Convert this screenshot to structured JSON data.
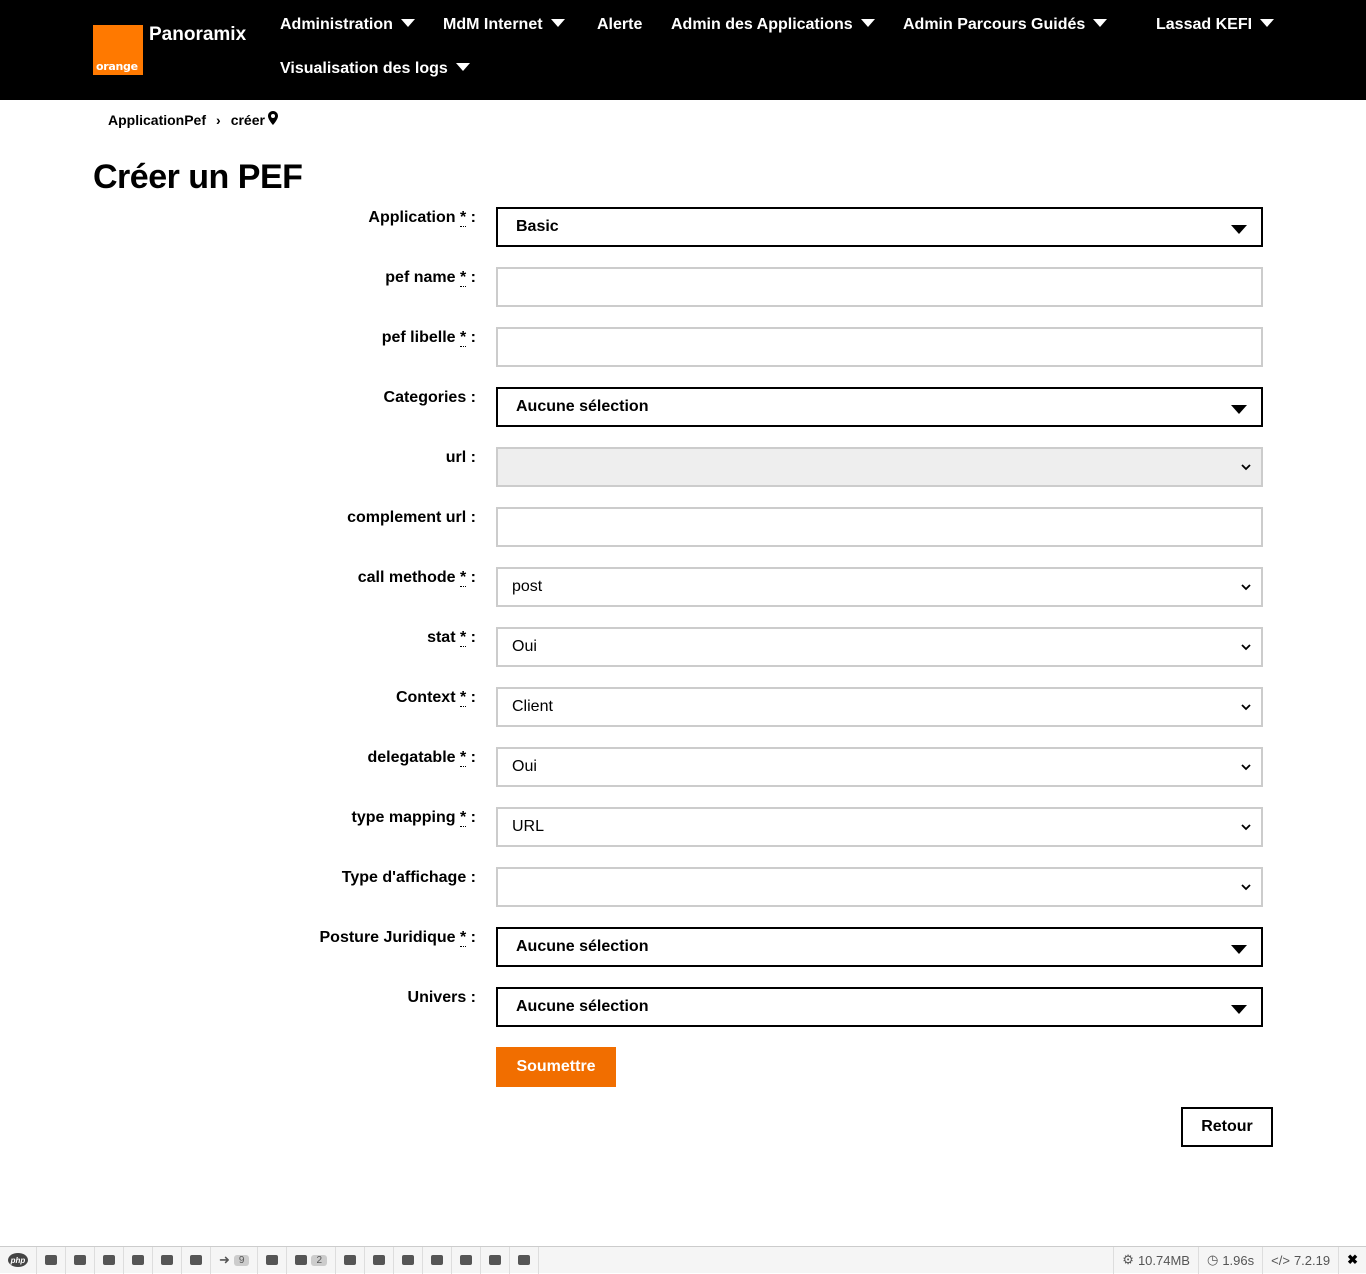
{
  "header": {
    "logo_text": "orange",
    "brand": "Panoramix",
    "nav": [
      {
        "label": "Administration"
      },
      {
        "label": "MdM Internet"
      },
      {
        "label": "Alerte"
      },
      {
        "label": "Admin des Applications"
      },
      {
        "label": "Admin Parcours Guidés"
      },
      {
        "label": "Lassad KEFI"
      },
      {
        "label": "Visualisation des logs"
      }
    ]
  },
  "breadcrumb": {
    "parent": "ApplicationPef",
    "current": "créer"
  },
  "page_title": "Créer un PEF",
  "form": {
    "required_marker": "*",
    "fields": [
      {
        "label": "Application",
        "required": true,
        "value": "Basic"
      },
      {
        "label": "pef name",
        "required": true,
        "value": ""
      },
      {
        "label": "pef libelle",
        "required": true,
        "value": ""
      },
      {
        "label": "Categories",
        "required": false,
        "value": "Aucune sélection"
      },
      {
        "label": "url",
        "required": false,
        "value": ""
      },
      {
        "label": "complement url",
        "required": false,
        "value": ""
      },
      {
        "label": "call methode",
        "required": true,
        "value": "post"
      },
      {
        "label": "stat",
        "required": true,
        "value": "Oui"
      },
      {
        "label": "Context",
        "required": true,
        "value": "Client"
      },
      {
        "label": "delegatable",
        "required": true,
        "value": "Oui"
      },
      {
        "label": "type mapping",
        "required": true,
        "value": "URL"
      },
      {
        "label": "Type d'affichage",
        "required": false,
        "value": ""
      },
      {
        "label": "Posture Juridique",
        "required": true,
        "value": "Aucune sélection"
      },
      {
        "label": "Univers",
        "required": false,
        "value": "Aucune sélection"
      }
    ],
    "submit_label": "Soumettre",
    "back_label": "Retour"
  },
  "debug_toolbar": {
    "php_label": "php",
    "forwards_count": "9",
    "views_count": "2",
    "memory": "10.74MB",
    "time": "1.96s",
    "php_version": "7.2.19",
    "close": "✖"
  }
}
